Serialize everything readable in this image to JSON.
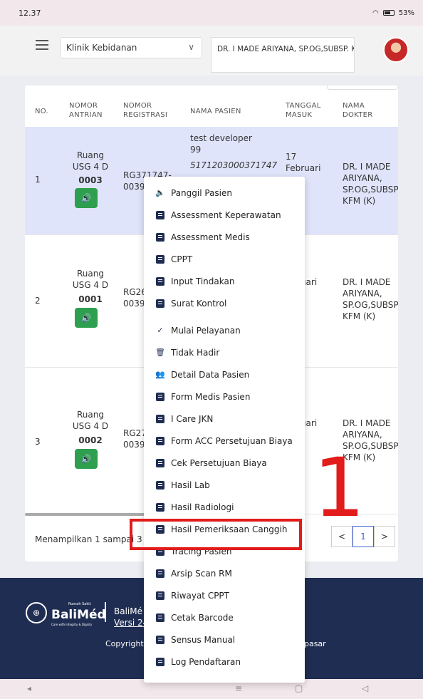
{
  "status_bar": {
    "time": "12.37",
    "battery": "53%"
  },
  "header": {
    "clinic": "Klinik Kebidanan",
    "doctor": "DR. I MADE ARIYANA, SP.OG,SUBSP. KFM (K)"
  },
  "table": {
    "headers": {
      "no": "NO.",
      "antrian": "NOMOR\nANTRIAN",
      "registrasi": "NOMOR\nREGISTRASI",
      "nama": "NAMA PASIEN",
      "tanggal": "TANGGAL\nMASUK",
      "dokter": "NAMA\nDOKTER"
    },
    "rows": [
      {
        "no": "1",
        "ruang": "Ruang\nUSG 4 D",
        "antrian": "0003",
        "reg": "RG371747-\n0039",
        "nama": "test developer\n99",
        "nrm": "5171203000371747",
        "tanggal": "17\nFebruari",
        "dokter": "DR. I MADE\nARIYANA,\nSP.OG,SUBSP.\nKFM (K)"
      },
      {
        "no": "2",
        "ruang": "Ruang\nUSG 4 D",
        "antrian": "0001",
        "reg": "RG26\n0039",
        "tanggal": "ruari\n5\nul\n)",
        "dokter": "DR. I MADE\nARIYANA,\nSP.OG,SUBSP.\nKFM (K)"
      },
      {
        "no": "3",
        "ruang": "Ruang\nUSG 4 D",
        "antrian": "0002",
        "reg": "RG27\n0039",
        "tanggal": "ruari\n5\nul\n)",
        "dokter": "DR. I MADE\nARIYANA,\nSP.OG,SUBSP.\nKFM (K)"
      }
    ],
    "footer_text": "Menampilkan 1 sampai 3",
    "page": "1"
  },
  "context_menu": {
    "items": [
      "Panggil Pasien",
      "Assessment Keperawatan",
      "Assessment Medis",
      "CPPT",
      "Input Tindakan",
      "Surat Kontrol",
      "Mulai Pelayanan",
      "Tidak Hadir",
      "Detail Data Pasien",
      "Form Medis Pasien",
      "I Care JKN",
      "Form ACC Persetujuan Biaya",
      "Cek Persetujuan Biaya",
      "Hasil Lab",
      "Hasil Radiologi",
      "Hasil Pemeriksaan Canggih",
      "Tracing Pasien",
      "Arsip Scan RM",
      "Riwayat CPPT",
      "Cetak Barcode",
      "Sensus Manual",
      "Log Pendaftaran"
    ],
    "highlighted": "Hasil Pemeriksaan Canggih"
  },
  "annotation": {
    "number": "1",
    "color": "#e21b1b"
  },
  "footer": {
    "logo_top": "Rumah Sakit",
    "logo_name": "BaliMéd",
    "logo_tagline": "Care with Integrity & Dignity",
    "app_name": "BaliMé",
    "version": "Versi 24",
    "copyright": "Copyright",
    "location": "npasar"
  },
  "colors": {
    "primary": "#1f2d52",
    "highlight_row": "#dfe4fa",
    "green": "#2e9e4f",
    "accent": "#3d63d8"
  }
}
